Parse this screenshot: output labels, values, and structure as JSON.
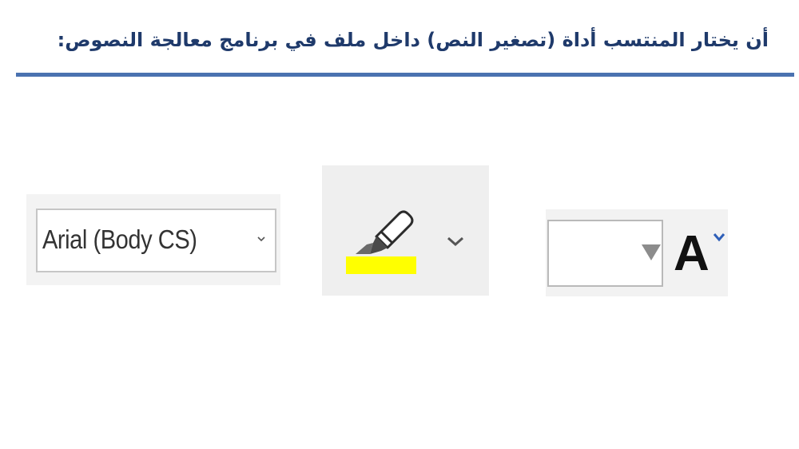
{
  "header": {
    "title": "أن يختار المنتسب أداة (تصغير النص) داخل ملف في برنامج معالجة النصوص:"
  },
  "font_dropdown": {
    "selected_value": "Arial (Body CS)",
    "icon": "chevron-down-icon"
  },
  "highlight_tool": {
    "icon": "highlighter-icon",
    "swatch_color": "#ffff00",
    "dropdown_icon": "chevron-down-icon"
  },
  "font_size": {
    "value": "",
    "icon": "triangle-down-icon"
  },
  "shrink_font": {
    "letter": "A",
    "icon": "caret-down-icon",
    "accent_color": "#2e5fb8"
  },
  "colors": {
    "title": "#1f3a6b",
    "rule": "#4a72b0"
  }
}
